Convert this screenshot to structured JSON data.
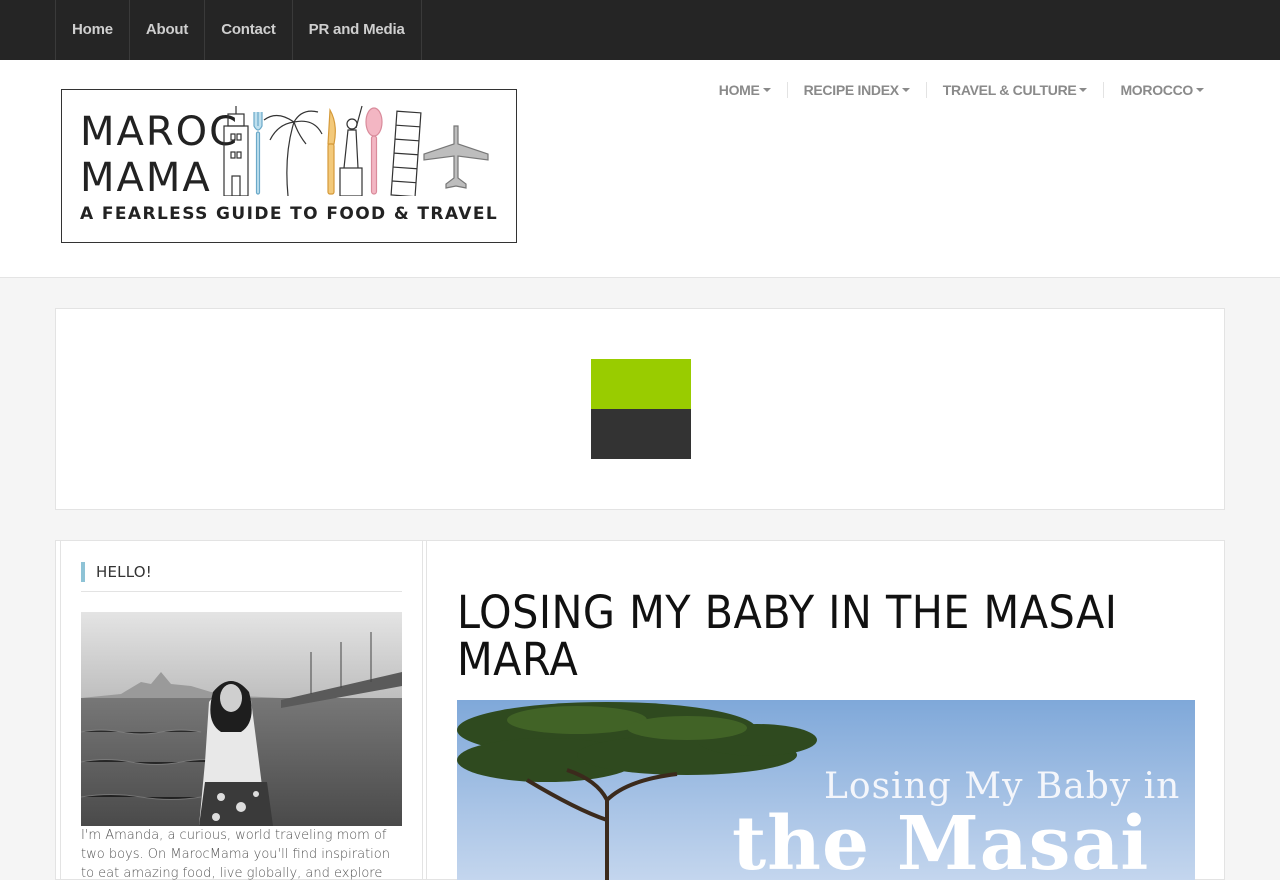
{
  "topnav": {
    "items": [
      {
        "label": "Home"
      },
      {
        "label": "About"
      },
      {
        "label": "Contact"
      },
      {
        "label": "PR and Media"
      }
    ]
  },
  "logo": {
    "line1": "MAROC",
    "line2": "MAMA",
    "tagline": "A FEARLESS GUIDE TO FOOD & TRAVEL"
  },
  "mainnav": {
    "items": [
      {
        "label": "HOME"
      },
      {
        "label": "RECIPE INDEX"
      },
      {
        "label": "TRAVEL & CULTURE"
      },
      {
        "label": "MOROCCO"
      }
    ]
  },
  "ad": {
    "colors": {
      "top": "#99cc00",
      "bottom": "#333333"
    }
  },
  "sidebar": {
    "widget_title": "HELLO!",
    "bio": "I'm Amanda, a curious, world traveling mom of two boys. On MarocMama you'll find inspiration to eat amazing food, live globally, and explore"
  },
  "article": {
    "title": "LOSING MY BABY IN THE MASAI MARA",
    "hero": {
      "line1": "Losing My Baby in",
      "line2": "the Masai"
    }
  }
}
